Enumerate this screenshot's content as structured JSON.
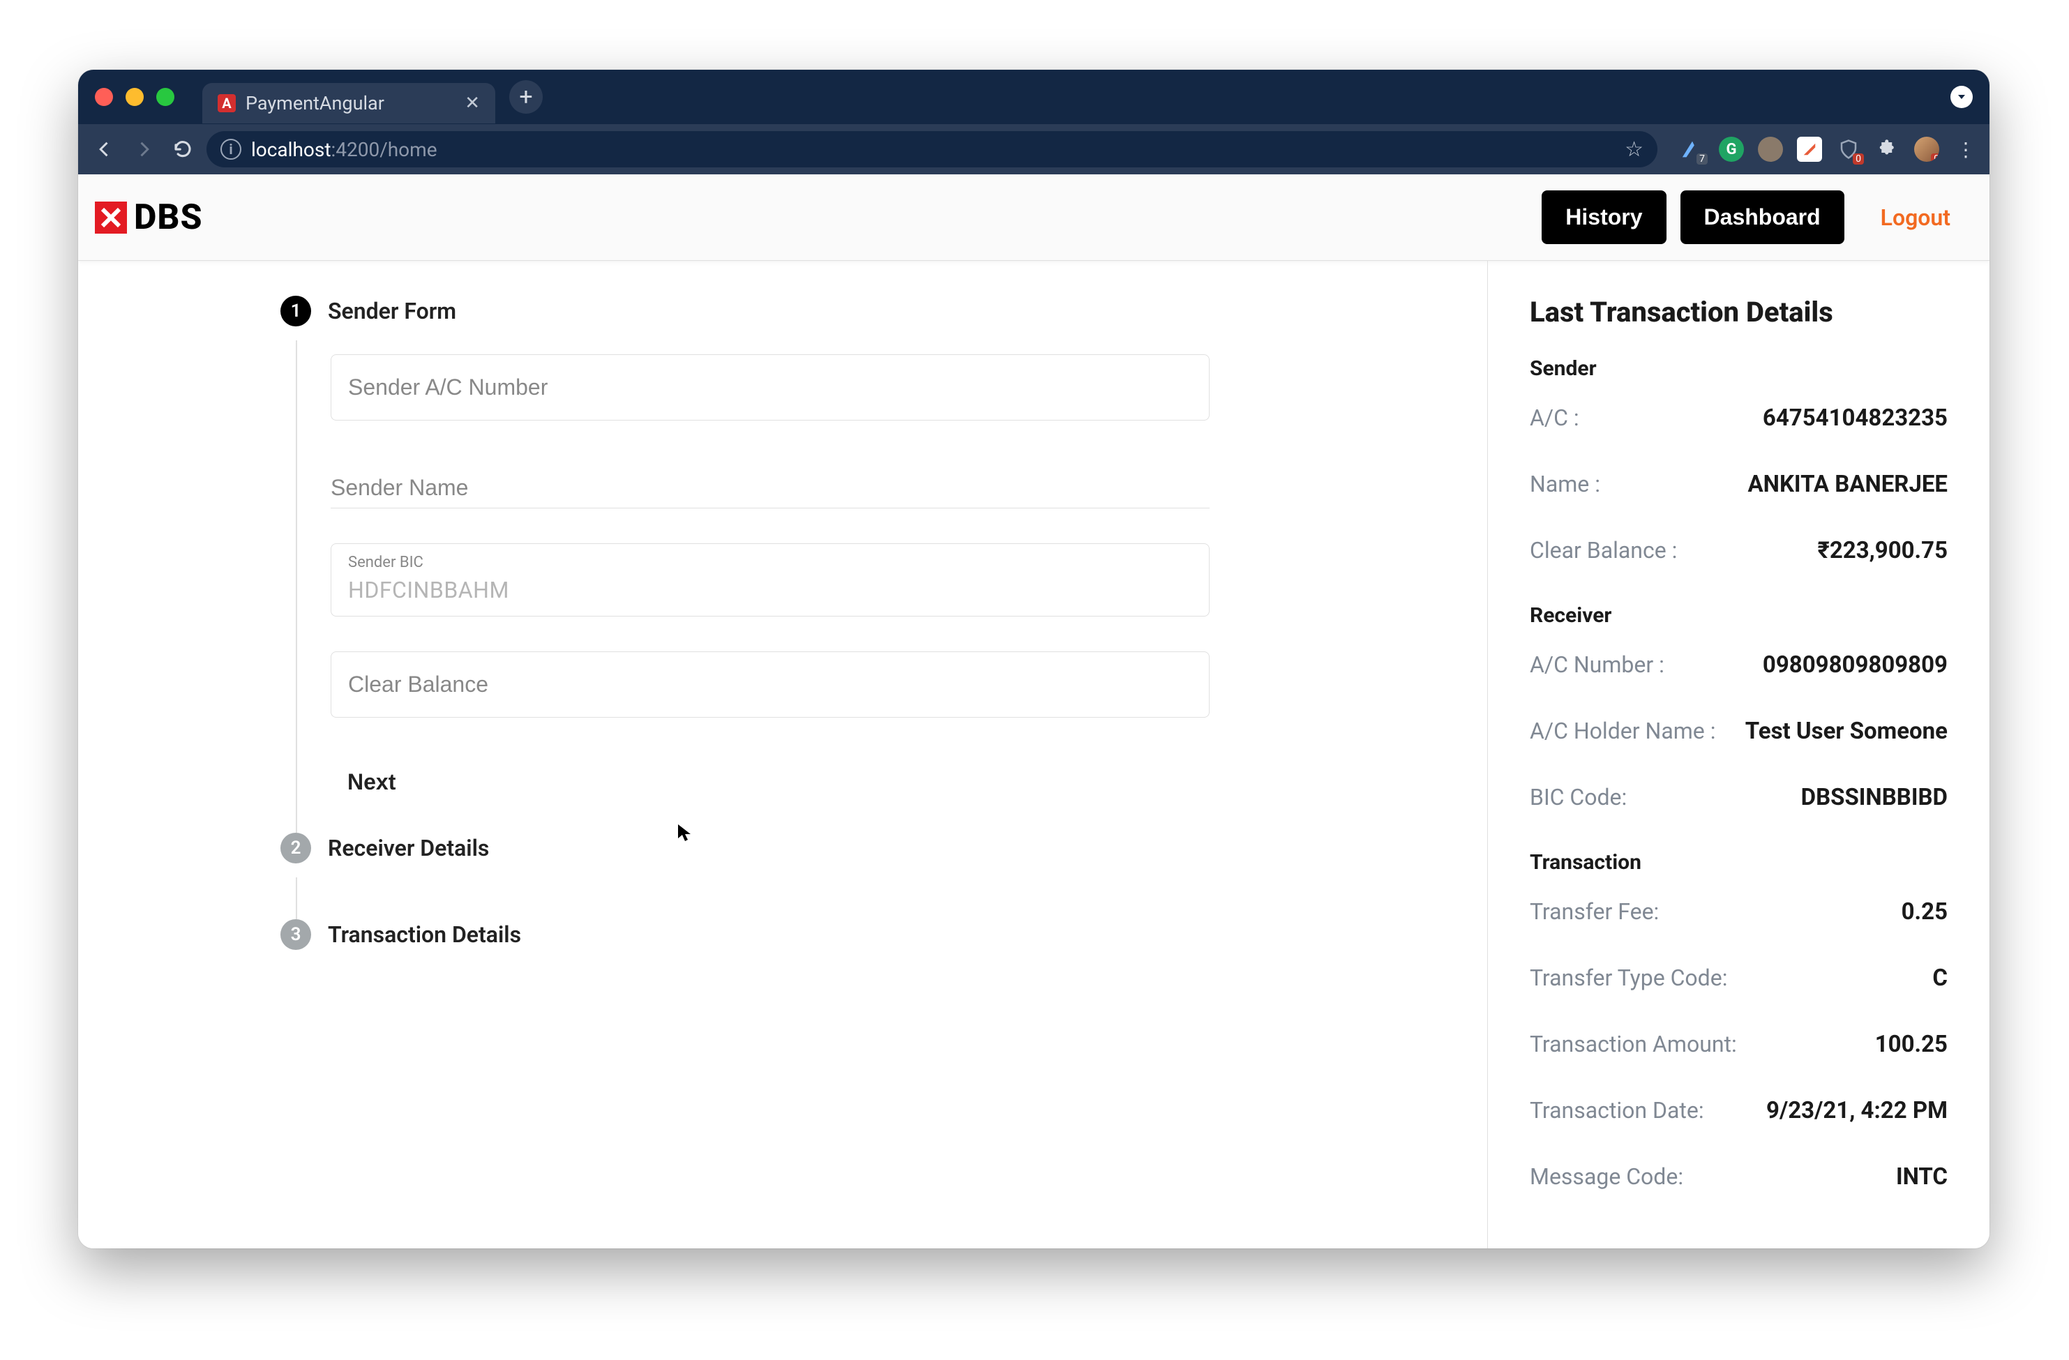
{
  "browser": {
    "tab_title": "PaymentAngular",
    "url_host": "localhost",
    "url_port_path": ":4200/home",
    "ext_badge_a": "7",
    "ext_badge_b": "0",
    "ext_badge_c": "0"
  },
  "header": {
    "brand": "DBS",
    "history": "History",
    "dashboard": "Dashboard",
    "logout": "Logout"
  },
  "stepper": {
    "step1": {
      "num": "1",
      "label": "Sender Form"
    },
    "step2": {
      "num": "2",
      "label": "Receiver Details"
    },
    "step3": {
      "num": "3",
      "label": "Transaction Details"
    },
    "next": "Next"
  },
  "form": {
    "ac_placeholder": "Sender A/C Number",
    "name_placeholder": "Sender Name",
    "bic_label": "Sender BIC",
    "bic_value": "HDFCINBBAHM",
    "balance_placeholder": "Clear Balance"
  },
  "side": {
    "title": "Last Transaction Details",
    "sender_section": "Sender",
    "receiver_section": "Receiver",
    "transaction_section": "Transaction",
    "sender": {
      "ac_label": "A/C :",
      "ac_value": "64754104823235",
      "name_label": "Name :",
      "name_value": "ANKITA BANERJEE",
      "balance_label": "Clear Balance :",
      "balance_value": "₹223,900.75"
    },
    "receiver": {
      "ac_label": "A/C Number :",
      "ac_value": "09809809809809",
      "holder_label": "A/C Holder Name :",
      "holder_value": "Test User Someone",
      "bic_label": "BIC Code:",
      "bic_value": "DBSSINBBIBD"
    },
    "transaction": {
      "fee_label": "Transfer Fee:",
      "fee_value": "0.25",
      "type_label": "Transfer Type Code:",
      "type_value": "C",
      "amount_label": "Transaction Amount:",
      "amount_value": "100.25",
      "date_label": "Transaction Date:",
      "date_value": "9/23/21, 4:22 PM",
      "msg_label": "Message Code:",
      "msg_value": "INTC"
    }
  }
}
